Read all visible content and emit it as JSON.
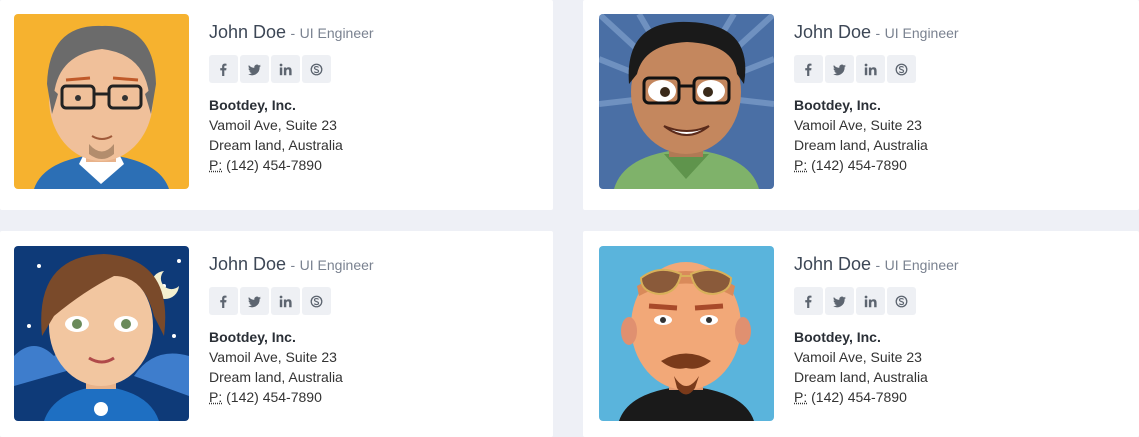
{
  "cards": [
    {
      "name": "John Doe",
      "role_prefix": "-",
      "role": "UI Engineer",
      "socials": [
        "facebook-icon",
        "twitter-icon",
        "linkedin-icon",
        "skype-icon"
      ],
      "company": "Bootdey, Inc.",
      "address1": "Vamoil Ave, Suite 23",
      "address2": "Dream land, Australia",
      "phone_label": "P:",
      "phone": "(142) 454-7890",
      "avatar_bg": "#f6b22f"
    },
    {
      "name": "John Doe",
      "role_prefix": "-",
      "role": "UI Engineer",
      "socials": [
        "facebook-icon",
        "twitter-icon",
        "linkedin-icon",
        "skype-icon"
      ],
      "company": "Bootdey, Inc.",
      "address1": "Vamoil Ave, Suite 23",
      "address2": "Dream land, Australia",
      "phone_label": "P:",
      "phone": "(142) 454-7890",
      "avatar_bg": "#4a6fa5"
    },
    {
      "name": "John Doe",
      "role_prefix": "-",
      "role": "UI Engineer",
      "socials": [
        "facebook-icon",
        "twitter-icon",
        "linkedin-icon",
        "skype-icon"
      ],
      "company": "Bootdey, Inc.",
      "address1": "Vamoil Ave, Suite 23",
      "address2": "Dream land, Australia",
      "phone_label": "P:",
      "phone": "(142) 454-7890",
      "avatar_bg": "#0e3a78"
    },
    {
      "name": "John Doe",
      "role_prefix": "-",
      "role": "UI Engineer",
      "socials": [
        "facebook-icon",
        "twitter-icon",
        "linkedin-icon",
        "skype-icon"
      ],
      "company": "Bootdey, Inc.",
      "address1": "Vamoil Ave, Suite 23",
      "address2": "Dream land, Australia",
      "phone_label": "P:",
      "phone": "(142) 454-7890",
      "avatar_bg": "#5ab4dc"
    }
  ],
  "colors": {
    "page_bg": "#eef0f6",
    "card_bg": "#ffffff",
    "social_bg": "#eef0f4"
  }
}
